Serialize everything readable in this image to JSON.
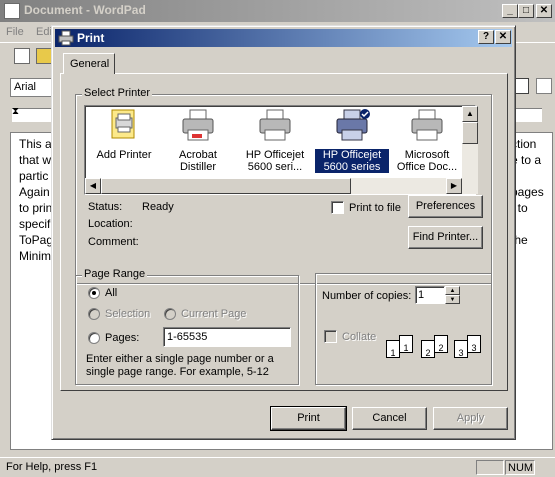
{
  "wordpad": {
    "title": "Document - WordPad",
    "menu": [
      "File",
      "Edi"
    ],
    "font_name": "Arial",
    "document_lines": [
      "This a",
      "that w",
      "partic",
      "Again",
      "to prin",
      "specif",
      "ToPag",
      "Minim"
    ],
    "document_right": [
      "ction",
      "e to a",
      "",
      "pages",
      "t to",
      "",
      "the",
      ""
    ],
    "status_text": "For Help, press F1",
    "status_num": "NUM"
  },
  "dialog": {
    "title": "Print",
    "help_button": "?",
    "close_button": "✕",
    "tab_general": "General",
    "select_printer_label": "Select Printer",
    "printers": [
      {
        "name": "Add Printer",
        "icon": "add-printer-icon"
      },
      {
        "name": "Acrobat Distiller",
        "icon": "printer-icon"
      },
      {
        "name": "HP Officejet 5600 seri...",
        "icon": "printer-icon"
      },
      {
        "name": "HP Officejet 5600 series",
        "icon": "default-printer-icon",
        "selected": true
      },
      {
        "name": "Microsoft Office Doc...",
        "icon": "printer-icon"
      }
    ],
    "status_label": "Status:",
    "status_value": "Ready",
    "location_label": "Location:",
    "comment_label": "Comment:",
    "print_to_file_label": "Print to file",
    "preferences_button": "Preferences",
    "find_printer_button": "Find Printer...",
    "page_range": {
      "label": "Page Range",
      "all_label": "All",
      "selection_label": "Selection",
      "current_page_label": "Current Page",
      "pages_label": "Pages:",
      "pages_value": "1-65535",
      "hint": "Enter either a single page number or a single page range.  For example, 5-12"
    },
    "copies": {
      "label": "Number of copies:",
      "value": "1",
      "collate_label": "Collate",
      "collate_pages": [
        "1",
        "1",
        "2",
        "2",
        "3",
        "3"
      ]
    },
    "buttons": {
      "print": "Print",
      "cancel": "Cancel",
      "apply": "Apply"
    }
  }
}
